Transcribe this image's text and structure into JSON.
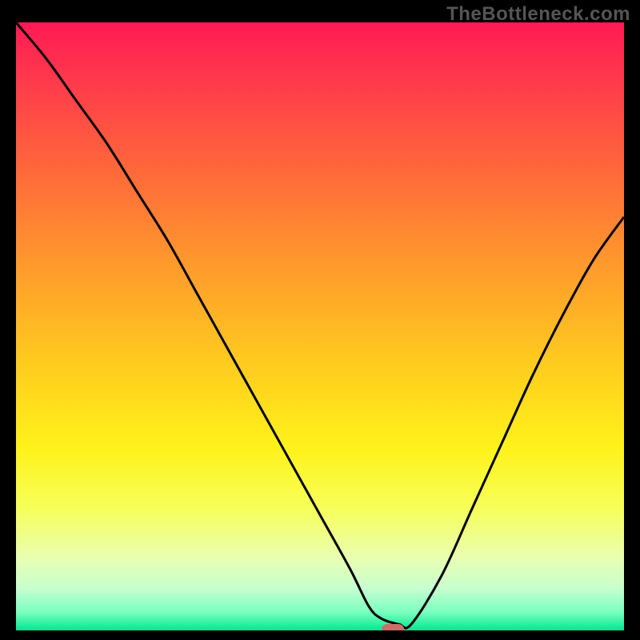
{
  "watermark": "TheBottleneck.com",
  "chart_data": {
    "type": "line",
    "title": "",
    "xlabel": "",
    "ylabel": "",
    "xlim": [
      0,
      100
    ],
    "ylim": [
      0,
      100
    ],
    "grid": false,
    "series": [
      {
        "name": "bottleneck-curve",
        "x": [
          0,
          5,
          10,
          15,
          20,
          25,
          30,
          35,
          40,
          45,
          50,
          55,
          58,
          60,
          63,
          65,
          70,
          75,
          80,
          85,
          90,
          95,
          100
        ],
        "y": [
          100,
          94,
          87,
          80,
          72,
          64,
          55,
          46,
          37,
          28,
          19,
          10,
          4,
          2,
          1,
          1,
          9,
          20,
          31,
          42,
          52,
          61,
          68
        ]
      }
    ],
    "marker": {
      "name": "optimal-point",
      "x": 62,
      "y": 0,
      "color": "#d36a6a"
    },
    "gradient_stops": [
      {
        "offset": 0.0,
        "color": "#ff1a55"
      },
      {
        "offset": 0.1,
        "color": "#ff3b4b"
      },
      {
        "offset": 0.25,
        "color": "#ff6a3a"
      },
      {
        "offset": 0.4,
        "color": "#ff9a2c"
      },
      {
        "offset": 0.55,
        "color": "#ffc81f"
      },
      {
        "offset": 0.7,
        "color": "#fff21a"
      },
      {
        "offset": 0.8,
        "color": "#f6ff5a"
      },
      {
        "offset": 0.88,
        "color": "#e9ffb0"
      },
      {
        "offset": 0.93,
        "color": "#c8ffd0"
      },
      {
        "offset": 0.97,
        "color": "#7affbf"
      },
      {
        "offset": 1.0,
        "color": "#00e88f"
      }
    ]
  }
}
